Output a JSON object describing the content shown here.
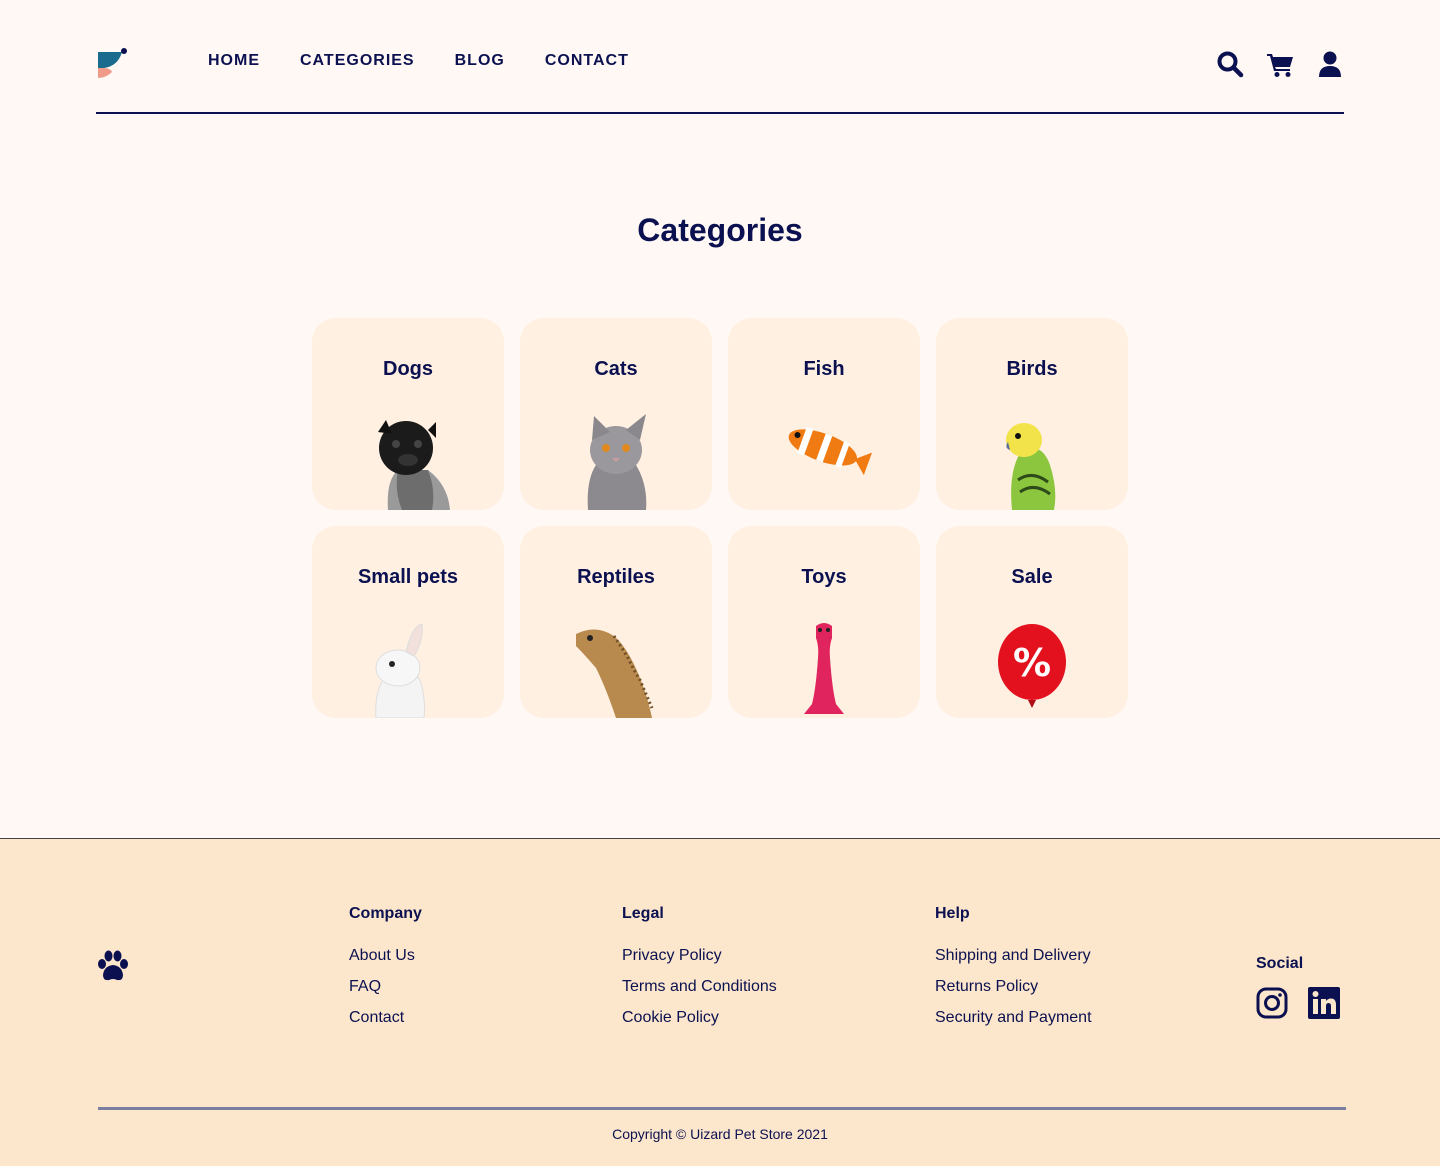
{
  "nav": {
    "items": [
      "HOME",
      "CATEGORIES",
      "BLOG",
      "CONTACT"
    ]
  },
  "header_icons": [
    "search-icon",
    "cart-icon",
    "user-icon"
  ],
  "main": {
    "title": "Categories",
    "categories": [
      {
        "label": "Dogs",
        "image": "pug-dog"
      },
      {
        "label": "Cats",
        "image": "grey-cat"
      },
      {
        "label": "Fish",
        "image": "clownfish"
      },
      {
        "label": "Birds",
        "image": "budgie"
      },
      {
        "label": "Small pets",
        "image": "white-rabbit"
      },
      {
        "label": "Reptiles",
        "image": "lizard"
      },
      {
        "label": "Toys",
        "image": "pink-toy"
      },
      {
        "label": "Sale",
        "image": "percent-balloon"
      }
    ]
  },
  "footer": {
    "company": {
      "title": "Company",
      "links": [
        "About Us",
        "FAQ",
        "Contact"
      ]
    },
    "legal": {
      "title": "Legal",
      "links": [
        "Privacy Policy",
        "Terms and Conditions",
        "Cookie Policy"
      ]
    },
    "help": {
      "title": "Help",
      "links": [
        "Shipping and Delivery",
        "Returns Policy",
        "Security and Payment"
      ]
    },
    "social": {
      "title": "Social",
      "icons": [
        "instagram-icon",
        "linkedin-icon"
      ]
    },
    "copyright": "Copyright © Uizard Pet Store 2021"
  },
  "colors": {
    "primary": "#0b1150",
    "background": "#fff8f4",
    "card": "#fff0e2",
    "footer": "#fce6cc"
  }
}
